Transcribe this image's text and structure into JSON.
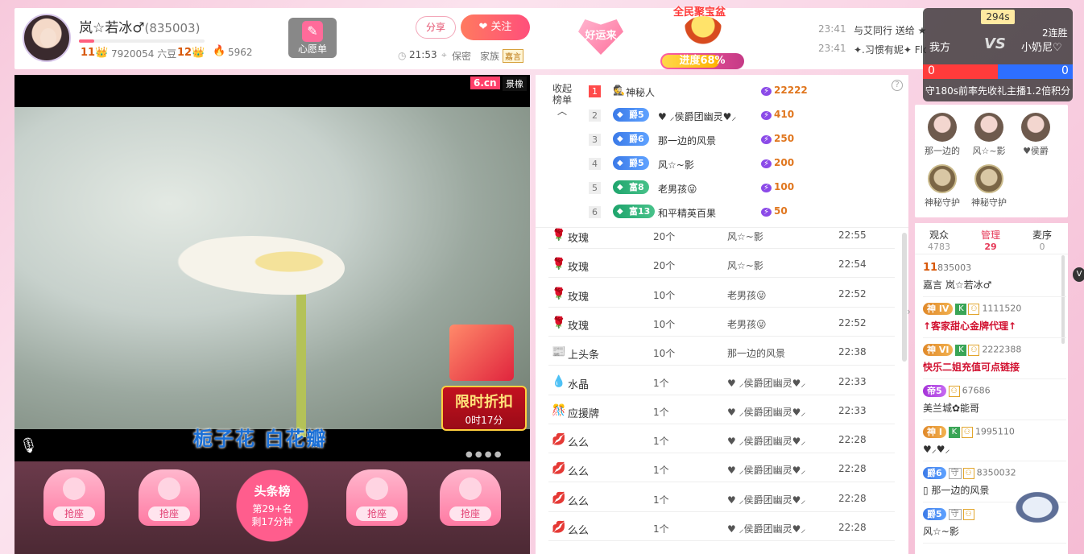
{
  "header": {
    "anchor_name": "岚☆若冰♂",
    "room_id": "(835003)",
    "wealth_level": "11",
    "beans": "7920054 六豆",
    "star_level": "12",
    "fire_value": "5962",
    "wish_label": "心愿单",
    "share_label": "分享",
    "follow_label": "关注",
    "time": "21:53",
    "location": "保密",
    "family_label": "家族",
    "family_badge": "嘉言",
    "luck_label": "好运来",
    "treasure_title": "全民聚宝盆",
    "treasure_progress_label": "进度68%",
    "treasure_progress": 0.68,
    "messages": [
      {
        "time": "23:41",
        "text": "与艾同行 送给 ★有小艾的每一天★ 飞机"
      },
      {
        "time": "23:41",
        "text": "✦.习惯有妮✦ Flower"
      }
    ]
  },
  "pk": {
    "seconds": "294s",
    "streak": "2连胜",
    "my_side": "我方",
    "vs": "VS",
    "opponent": "小奶尼♡",
    "my_score": "0",
    "opp_score": "0",
    "tip": "守180s前率先收礼主播1.2倍积分"
  },
  "video": {
    "logo": "6.cn",
    "logo_tag": "景橡",
    "caption": "栀子花 白花瓣",
    "sale_title": "限时折扣",
    "sale_timer": "0时17分",
    "seats": [
      "抢座",
      "抢座",
      "抢座",
      "抢座"
    ],
    "toplist_title": "头条榜",
    "toplist_rank": "第29+名",
    "toplist_remain": "剩17分钟"
  },
  "rank": {
    "toggle_label": "收起榜单",
    "help": "?",
    "rows": [
      {
        "num": "1",
        "badge": "",
        "badge_type": "",
        "name": "神秘人",
        "value": "22222"
      },
      {
        "num": "2",
        "badge": "爵5",
        "badge_type": "jue",
        "name": "♥ ⸝侯爵团幽灵♥⸝",
        "value": "410"
      },
      {
        "num": "3",
        "badge": "爵6",
        "badge_type": "jue",
        "name": "那一边的风景",
        "value": "250"
      },
      {
        "num": "4",
        "badge": "爵5",
        "badge_type": "jue",
        "name": "风☆~影",
        "value": "200"
      },
      {
        "num": "5",
        "badge": "富8",
        "badge_type": "fu",
        "name": "老男孩😜",
        "value": "100"
      },
      {
        "num": "6",
        "badge": "富13",
        "badge_type": "fu",
        "name": "和平精英百果",
        "value": "50"
      }
    ]
  },
  "gifts": [
    {
      "icon": "🌹",
      "name": "玫瑰",
      "count": "20个",
      "user": "风☆~影",
      "time": "22:55"
    },
    {
      "icon": "🌹",
      "name": "玫瑰",
      "count": "20个",
      "user": "风☆~影",
      "time": "22:54"
    },
    {
      "icon": "🌹",
      "name": "玫瑰",
      "count": "10个",
      "user": "老男孩😜",
      "time": "22:52"
    },
    {
      "icon": "🌹",
      "name": "玫瑰",
      "count": "10个",
      "user": "老男孩😜",
      "time": "22:52"
    },
    {
      "icon": "📰",
      "name": "上头条",
      "count": "10个",
      "user": "那一边的风景",
      "time": "22:38"
    },
    {
      "icon": "💧",
      "name": "水晶",
      "count": "1个",
      "user": "♥ ⸝侯爵团幽灵♥⸝",
      "time": "22:33"
    },
    {
      "icon": "🎊",
      "name": "应援牌",
      "count": "1个",
      "user": "♥ ⸝侯爵团幽灵♥⸝",
      "time": "22:33"
    },
    {
      "icon": "💋",
      "name": "么么",
      "count": "1个",
      "user": "♥ ⸝侯爵团幽灵♥⸝",
      "time": "22:28"
    },
    {
      "icon": "💋",
      "name": "么么",
      "count": "1个",
      "user": "♥ ⸝侯爵团幽灵♥⸝",
      "time": "22:28"
    },
    {
      "icon": "💋",
      "name": "么么",
      "count": "1个",
      "user": "♥ ⸝侯爵团幽灵♥⸝",
      "time": "22:28"
    },
    {
      "icon": "💋",
      "name": "么么",
      "count": "1个",
      "user": "♥ ⸝侯爵团幽灵♥⸝",
      "time": "22:28"
    }
  ],
  "guards": [
    {
      "name": "那一边的",
      "mystery": false
    },
    {
      "name": "风☆~影",
      "mystery": false
    },
    {
      "name": "♥侯爵",
      "mystery": false
    },
    {
      "name": "神秘守护",
      "mystery": true
    },
    {
      "name": "神秘守护",
      "mystery": true
    }
  ],
  "user_tabs": [
    {
      "label": "观众",
      "count": "4783"
    },
    {
      "label": "管理",
      "count": "29"
    },
    {
      "label": "麦序",
      "count": "0"
    }
  ],
  "users": [
    {
      "badge": "11",
      "badge_type": "lvl",
      "tags": "",
      "id": "835003",
      "name": "嘉言 岚☆若冰♂",
      "red": false
    },
    {
      "badge": "神 IV",
      "badge_type": "shen",
      "tags": "K",
      "id": "1111520",
      "name": "↑客家甜心金牌代理↑",
      "red": true
    },
    {
      "badge": "神 VI",
      "badge_type": "shen",
      "tags": "K",
      "id": "2222388",
      "name": "快乐二姐充值可点链接",
      "red": true
    },
    {
      "badge": "帝5",
      "badge_type": "di",
      "tags": "",
      "id": "67686",
      "name": "美兰城✿能哥",
      "red": false
    },
    {
      "badge": "神 I",
      "badge_type": "shen",
      "tags": "K",
      "id": "1995110",
      "name": "♥⸝♥⸝",
      "red": false
    },
    {
      "badge": "爵6",
      "badge_type": "jue",
      "tags": "守",
      "id": "8350032",
      "name": "▯ 那一边的风景",
      "red": false
    },
    {
      "badge": "爵5",
      "badge_type": "jue",
      "tags": "守",
      "id": "",
      "name": "风☆~影",
      "red": false
    }
  ]
}
